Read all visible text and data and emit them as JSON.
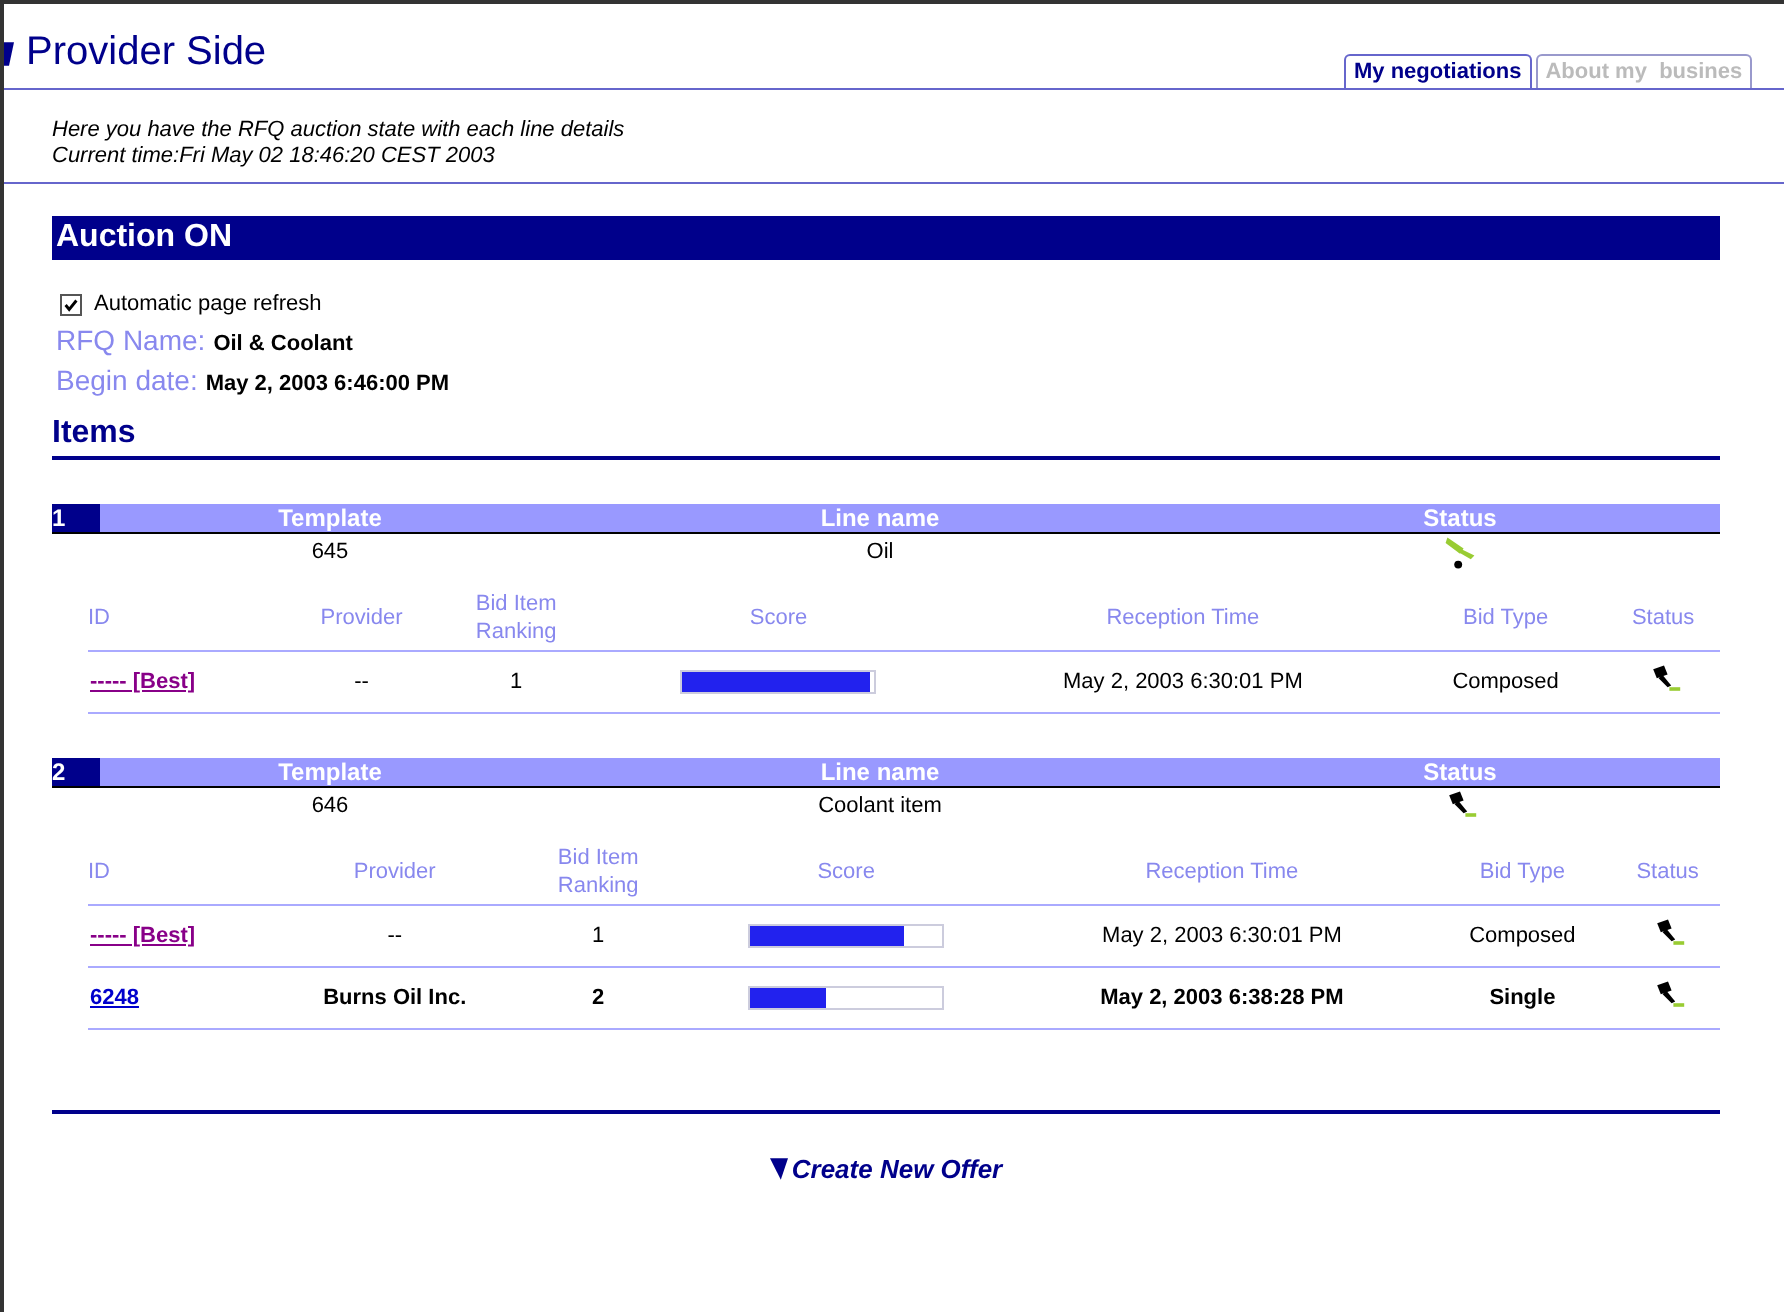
{
  "header": {
    "title": "Provider Side"
  },
  "tabs": [
    {
      "label": "My negotiations",
      "selected": true
    },
    {
      "label": "About my  busines",
      "selected": false
    }
  ],
  "intro": [
    "Here you have the RFQ auction state with each line details",
    "Current time:Fri May 02 18:46:20 CEST 2003"
  ],
  "banner": "Auction ON",
  "auto_refresh": {
    "label": "Automatic page refresh",
    "checked": true
  },
  "fields": [
    {
      "label": "RFQ Name:",
      "value": "Oil & Coolant"
    },
    {
      "label": "Begin date:",
      "value": "May 2, 2003 6:46:00 PM"
    }
  ],
  "items_heading": "Items",
  "lines": [
    {
      "number": "1",
      "line_columns": [
        "Template",
        "Line name",
        "Status"
      ],
      "bid_columns": [
        "ID",
        "Provider",
        "Bid Item Ranking",
        "Score",
        "Reception Time",
        "Bid Type",
        "Status"
      ],
      "template": "645",
      "name": "Oil",
      "status_raised": true,
      "bids": [
        {
          "id": "----- [Best]",
          "visited": true,
          "emphasized": false,
          "provider": "--",
          "ranking": "1",
          "level": 0.98,
          "time": "May 2, 2003 6:30:01 PM",
          "type": "Composed"
        }
      ]
    },
    {
      "number": "2",
      "line_columns": [
        "Template",
        "Line name",
        "Status"
      ],
      "bid_columns": [
        "ID",
        "Provider",
        "Bid Item Ranking",
        "Score",
        "Reception Time",
        "Bid Type",
        "Status"
      ],
      "template": "646",
      "name": "Coolant item",
      "status_raised": false,
      "bids": [
        {
          "id": "----- [Best]",
          "visited": true,
          "emphasized": false,
          "provider": "--",
          "ranking": "1",
          "level": 0.8,
          "time": "May 2, 2003 6:30:01 PM",
          "type": "Composed"
        },
        {
          "id": "6248",
          "visited": false,
          "emphasized": true,
          "provider": "Burns Oil Inc.",
          "ranking": "2",
          "level": 0.4,
          "time": "May 2, 2003 6:38:28 PM",
          "type": "Single"
        }
      ]
    }
  ],
  "footer_link": "Create New Offer"
}
